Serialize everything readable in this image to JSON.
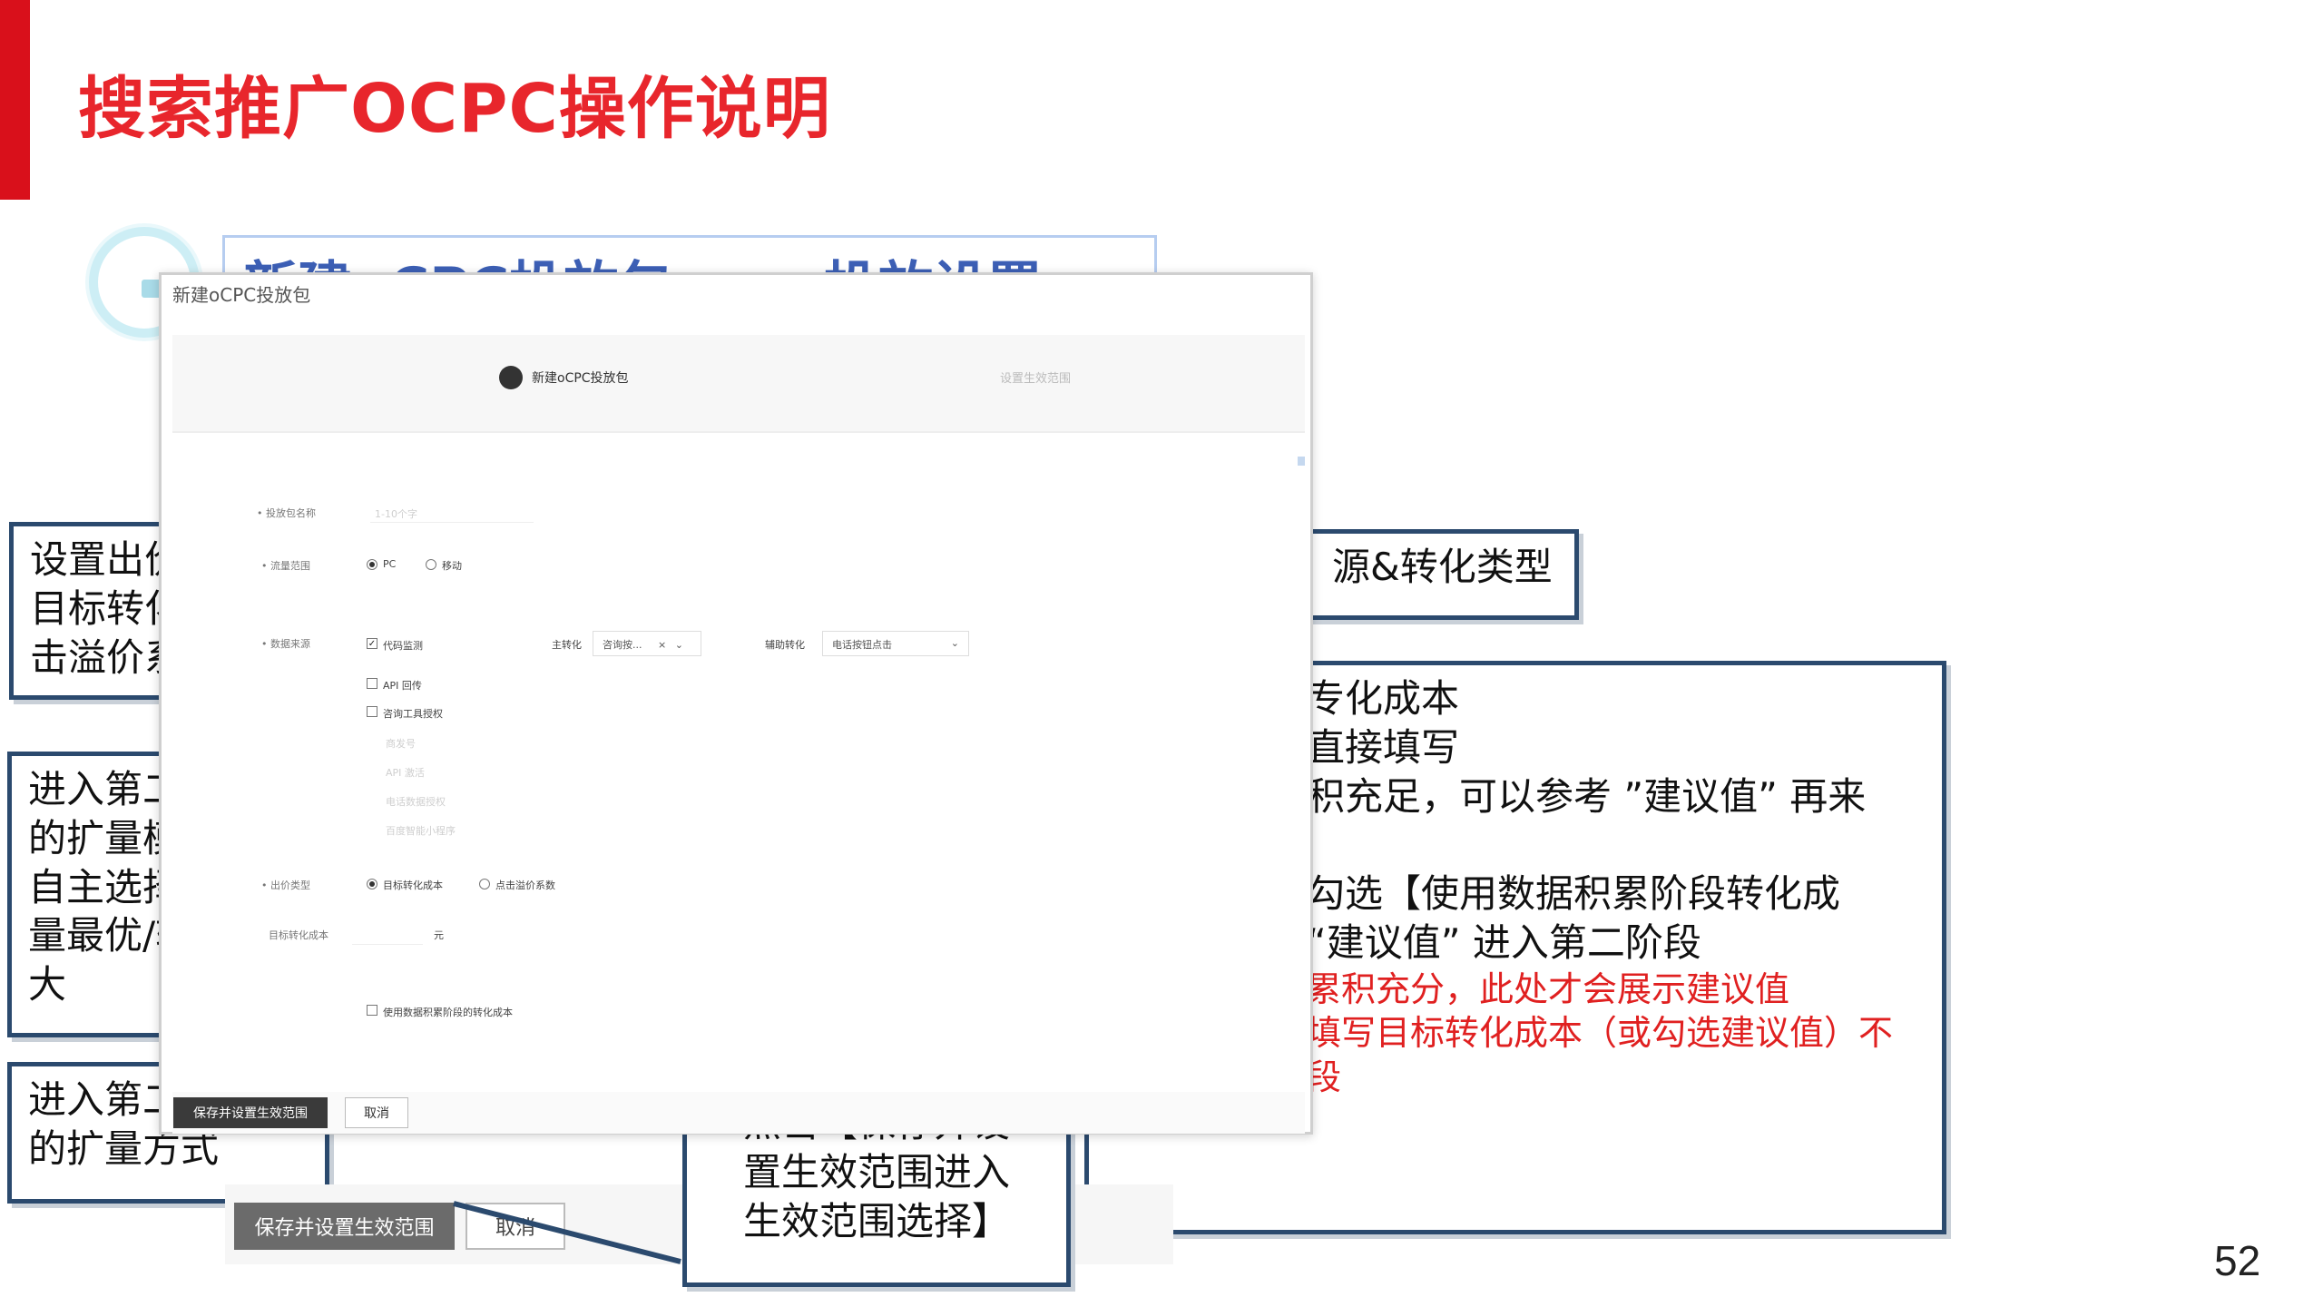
{
  "slide": {
    "title": "搜索推广OCPC操作说明",
    "page_number": "52",
    "header_left": "新建oCPC投放包",
    "header_right": "投放设置"
  },
  "modal": {
    "title": "新建oCPC投放包",
    "steps": [
      "新建oCPC投放包",
      "设置生效范围"
    ],
    "fields": {
      "package_name_label": "• 投放包名称",
      "package_name_placeholder": "1-10个字",
      "traffic_label": "• 流量范围",
      "traffic_options": [
        "PC",
        "移动"
      ],
      "data_source_label": "• 数据来源",
      "data_source_options": [
        "代码监测",
        "API 回传",
        "咨询工具授权"
      ],
      "data_source_suboptions": [
        "商发号",
        "API 激活",
        "电话数据授权",
        "百度智能小程序"
      ],
      "main_conversion_label": "主转化",
      "main_conversion_value": "咨询按...",
      "main_conversion_clear": "×",
      "aux_conversion_label": "辅助转化",
      "aux_conversion_value": "电话按钮点击",
      "bid_type_label": "• 出价类型",
      "bid_type_options": [
        "目标转化成本",
        "点击溢价系数"
      ],
      "target_cost_label": "目标转化成本",
      "target_cost_unit": "元",
      "accum_option": "使用数据积累阶段的转化成本"
    },
    "buttons": {
      "save": "保存并设置生效范围",
      "cancel": "取消"
    }
  },
  "callouts": {
    "left1": [
      "设置出价",
      "目标转化",
      "击溢价系"
    ],
    "left2": [
      "进入第二",
      "的扩量模",
      "自主选择",
      "量最优/转",
      "大"
    ],
    "left3": [
      "进入第二",
      "的扩量方式"
    ],
    "right1": [
      "源&转化类型"
    ],
    "right2": [
      "专化成本",
      "直接填写",
      "积充足，可以参考 ”建议值” 再来",
      "",
      "勾选【使用数据积累阶段转化成",
      "“建议值” 进入第二阶段"
    ],
    "right2_red": [
      "累积充分，此处才会展示建议值",
      "填写目标转化成本（或勾选建议值）不",
      "段"
    ],
    "bottom": [
      "点击【保存并设",
      "置生效范围进入",
      "生效范围选择】"
    ]
  },
  "ghost_buttons": {
    "save": "保存并设置生效范围",
    "cancel": "取消"
  },
  "colors": {
    "title_red": "#e8262c",
    "accent_red_bar": "#d9101b",
    "callout_border": "#2b4a6e",
    "callout_red_text": "#e02020"
  }
}
